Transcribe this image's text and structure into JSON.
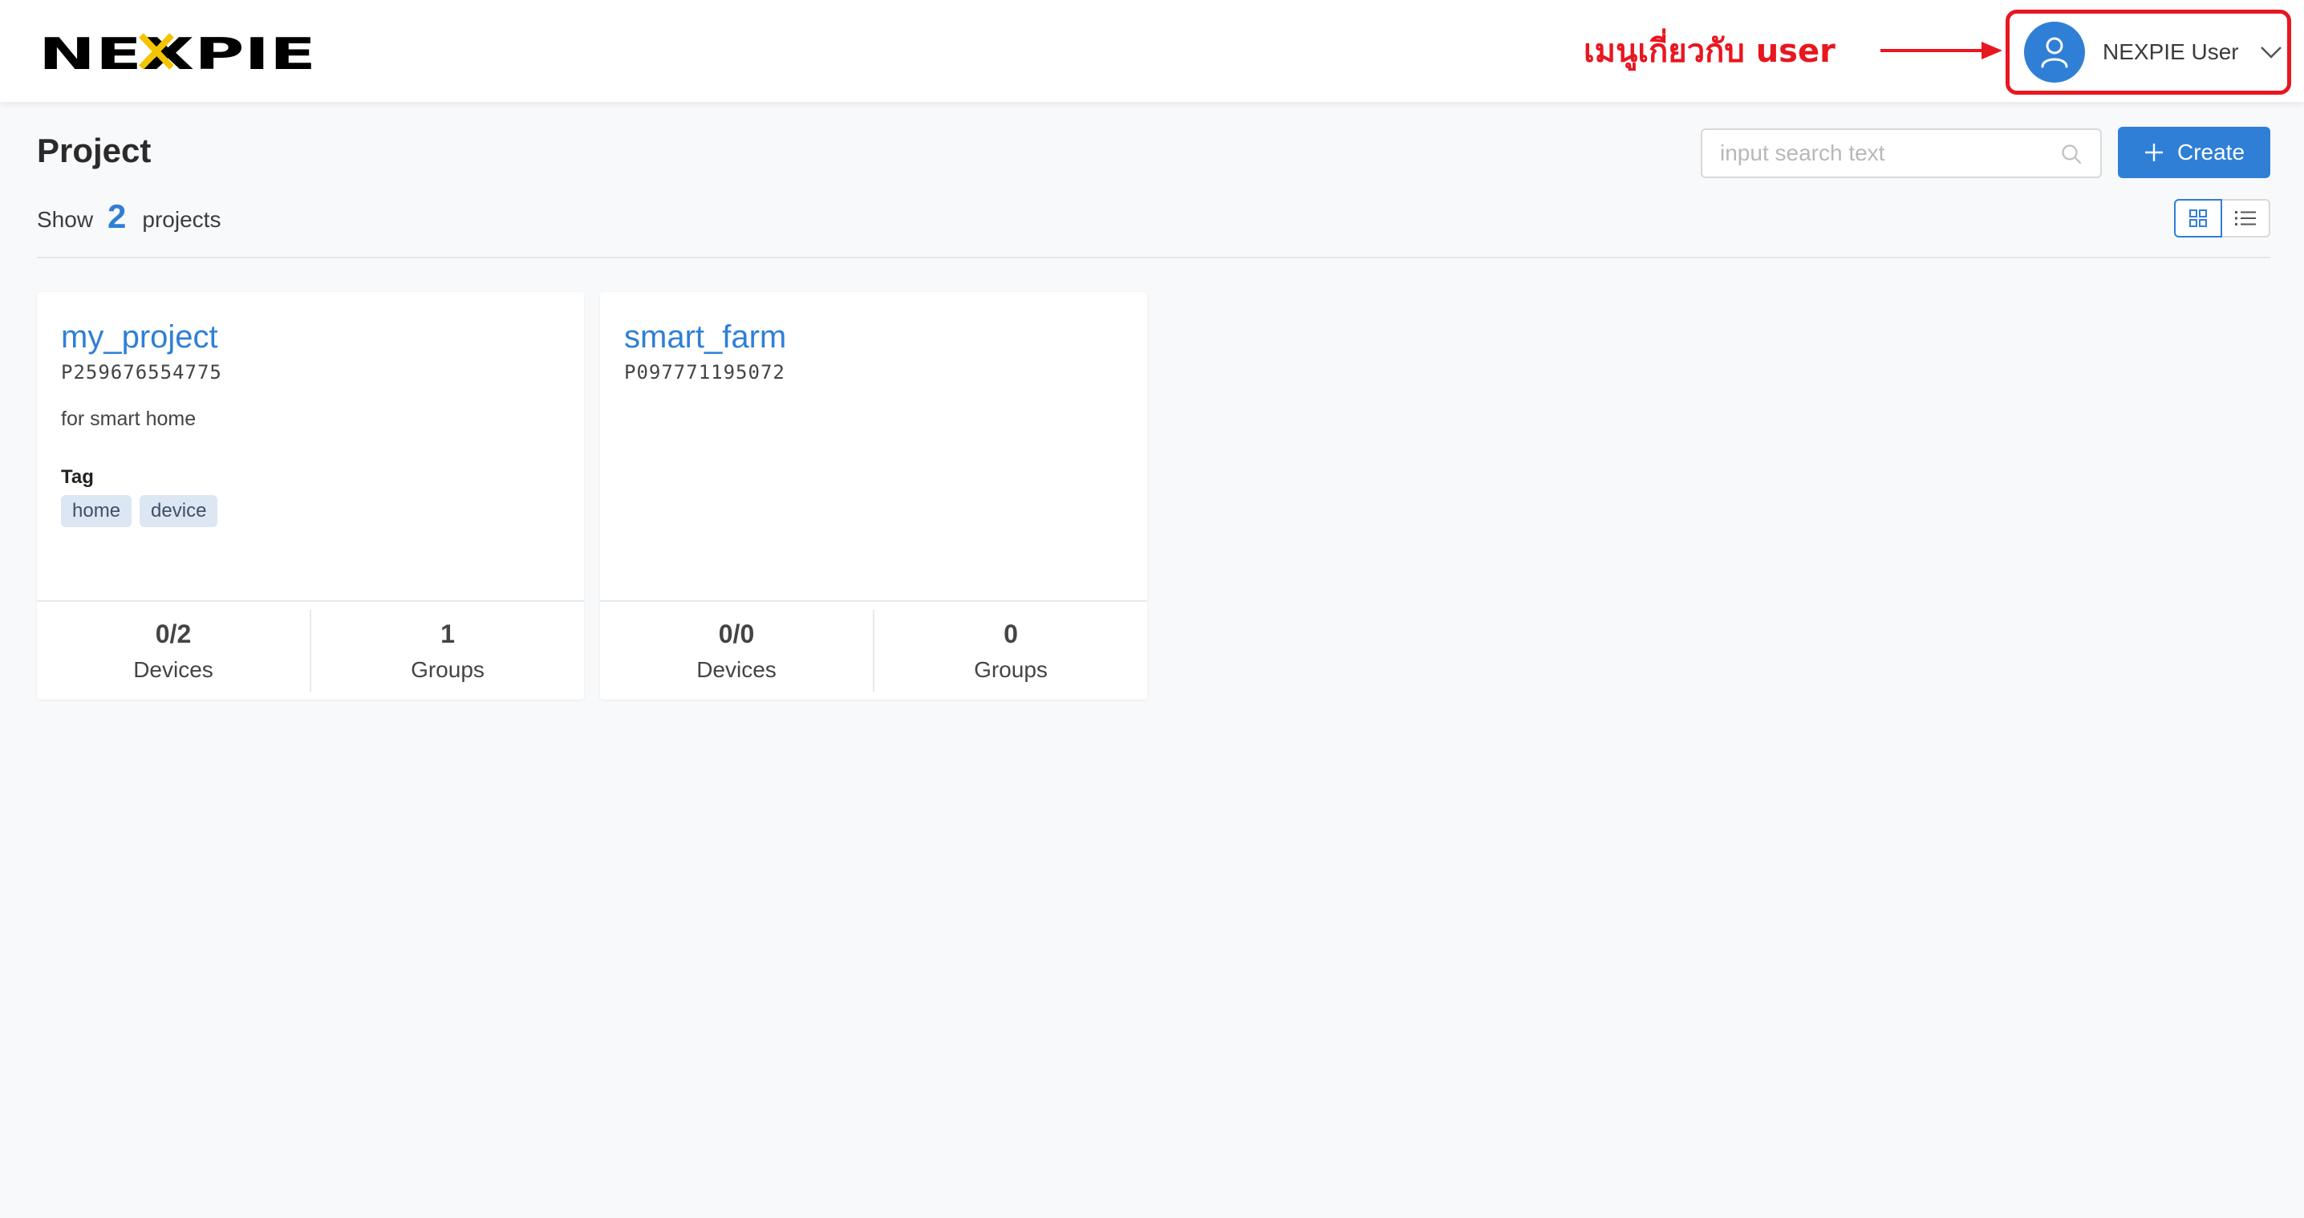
{
  "brand": {
    "logo_text": "NEXPIE",
    "accent_color": "#2f7fd6",
    "logo_x_color": "#f2c500",
    "annotation_color": "#e8161f"
  },
  "header": {
    "annotation": "เมนูเกี่ยวกับ user",
    "user": {
      "name": "NEXPIE User",
      "avatar_icon": "user-icon",
      "menu_icon": "chevron-down-icon"
    }
  },
  "page": {
    "title": "Project",
    "search": {
      "placeholder": "input search text",
      "value": "",
      "icon": "search-icon"
    },
    "create_label": "Create",
    "show_prefix": "Show",
    "project_count": "2",
    "show_suffix": "projects",
    "view_modes": [
      "grid",
      "list"
    ],
    "active_view": "grid"
  },
  "projects": [
    {
      "name": "my_project",
      "id": "P259676554775",
      "description": "for smart home",
      "tag_label": "Tag",
      "tags": [
        "home",
        "device"
      ],
      "devices": "0/2",
      "devices_label": "Devices",
      "groups": "1",
      "groups_label": "Groups"
    },
    {
      "name": "smart_farm",
      "id": "P097771195072",
      "description": "",
      "tag_label": "",
      "tags": [],
      "devices": "0/0",
      "devices_label": "Devices",
      "groups": "0",
      "groups_label": "Groups"
    }
  ]
}
